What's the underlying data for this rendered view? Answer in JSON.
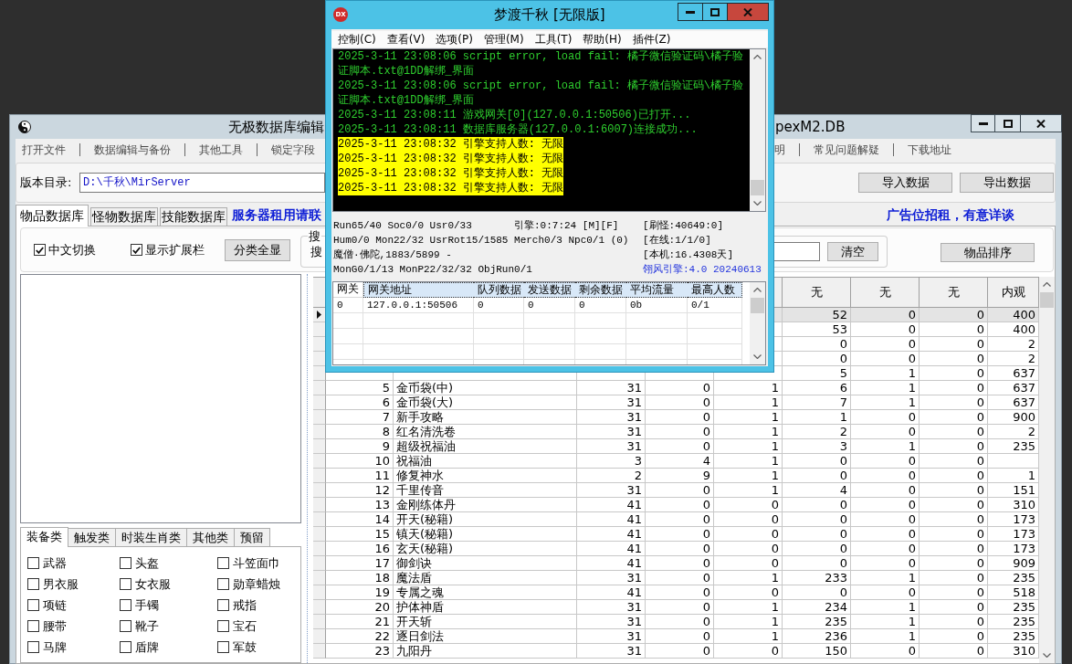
{
  "editor_window": {
    "title_left": "无极数据库编辑",
    "title_right": "pexM2.DB",
    "menu_left": [
      "打开文件",
      "数据编辑与备份",
      "其他工具",
      "锁定字段"
    ],
    "menu_right": [
      "明",
      "常见问题解疑",
      "下载地址"
    ],
    "directory": {
      "label": "版本目录:",
      "value": "D:\\千秋\\MirServer"
    },
    "import_button": "导入数据",
    "export_button": "导出数据",
    "tabs": [
      {
        "label": "物品数据库",
        "selected": true
      },
      {
        "label": "怪物数据库",
        "selected": false
      },
      {
        "label": "技能数据库",
        "selected": false
      }
    ],
    "notice": "服务器租用请联",
    "ad": "广告位招租，有意详谈",
    "options": [
      {
        "label": "中文切换",
        "checked": true
      },
      {
        "label": "显示扩展栏",
        "checked": true
      }
    ],
    "show_all_button": "分类全显",
    "search": {
      "title": "搜",
      "label": "搜",
      "clear_button": "清空"
    },
    "sort_button": "物品排序",
    "category_tabs": [
      {
        "label": "装备类",
        "selected": true
      },
      {
        "label": "触发类",
        "selected": false
      },
      {
        "label": "时装生肖类",
        "selected": false
      },
      {
        "label": "其他类",
        "selected": false
      },
      {
        "label": "预留",
        "selected": false
      }
    ],
    "categories": [
      {
        "label": "武器",
        "checked": false
      },
      {
        "label": "头盔",
        "checked": false
      },
      {
        "label": "斗笠面巾",
        "checked": false
      },
      {
        "label": "男衣服",
        "checked": false
      },
      {
        "label": "女衣服",
        "checked": false
      },
      {
        "label": "勋章蜡烛",
        "checked": false
      },
      {
        "label": "项链",
        "checked": false
      },
      {
        "label": "手镯",
        "checked": false
      },
      {
        "label": "戒指",
        "checked": false
      },
      {
        "label": "腰带",
        "checked": false
      },
      {
        "label": "靴子",
        "checked": false
      },
      {
        "label": "宝石",
        "checked": false
      },
      {
        "label": "马牌",
        "checked": false
      },
      {
        "label": "盾牌",
        "checked": false
      },
      {
        "label": "军鼓",
        "checked": false
      }
    ],
    "table": {
      "columns": [
        null,
        null,
        null,
        null,
        null,
        "无",
        "无",
        "无",
        "内观"
      ],
      "rows": [
        {
          "selected": true,
          "cells": [
            null,
            null,
            null,
            null,
            null,
            "52",
            "0",
            "0",
            "400"
          ]
        },
        {
          "selected": false,
          "cells": [
            null,
            null,
            null,
            null,
            null,
            "53",
            "0",
            "0",
            "400"
          ]
        },
        {
          "selected": false,
          "cells": [
            null,
            null,
            null,
            null,
            null,
            "0",
            "0",
            "0",
            "2"
          ]
        },
        {
          "selected": false,
          "cells": [
            null,
            null,
            null,
            null,
            null,
            "0",
            "0",
            "0",
            "2"
          ]
        },
        {
          "selected": false,
          "cells": [
            null,
            null,
            null,
            null,
            null,
            "5",
            "1",
            "0",
            "637"
          ]
        },
        {
          "selected": false,
          "cells": [
            "5",
            "金币袋(中)",
            "31",
            "0",
            "1",
            "6",
            "1",
            "0",
            "637"
          ]
        },
        {
          "selected": false,
          "cells": [
            "6",
            "金币袋(大)",
            "31",
            "0",
            "1",
            "7",
            "1",
            "0",
            "637"
          ]
        },
        {
          "selected": false,
          "cells": [
            "7",
            "新手攻略",
            "31",
            "0",
            "1",
            "1",
            "0",
            "0",
            "900"
          ]
        },
        {
          "selected": false,
          "cells": [
            "8",
            "红名清洗卷",
            "31",
            "0",
            "1",
            "2",
            "0",
            "0",
            "2"
          ]
        },
        {
          "selected": false,
          "cells": [
            "9",
            "超级祝福油",
            "31",
            "0",
            "1",
            "3",
            "1",
            "0",
            "235"
          ]
        },
        {
          "selected": false,
          "cells": [
            "10",
            "祝福油",
            "3",
            "4",
            "1",
            "0",
            "0",
            "0",
            null
          ]
        },
        {
          "selected": false,
          "cells": [
            "11",
            "修复神水",
            "2",
            "9",
            "1",
            "0",
            "0",
            "0",
            "1"
          ]
        },
        {
          "selected": false,
          "cells": [
            "12",
            "千里传音",
            "31",
            "0",
            "1",
            "4",
            "0",
            "0",
            "151"
          ]
        },
        {
          "selected": false,
          "cells": [
            "13",
            "金刚练体丹",
            "41",
            "0",
            "0",
            "0",
            "0",
            "0",
            "310"
          ]
        },
        {
          "selected": false,
          "cells": [
            "14",
            "开天(秘籍)",
            "41",
            "0",
            "0",
            "0",
            "0",
            "0",
            "173"
          ]
        },
        {
          "selected": false,
          "cells": [
            "15",
            "镇天(秘籍)",
            "41",
            "0",
            "0",
            "0",
            "0",
            "0",
            "173"
          ]
        },
        {
          "selected": false,
          "cells": [
            "16",
            "玄天(秘籍)",
            "41",
            "0",
            "0",
            "0",
            "0",
            "0",
            "173"
          ]
        },
        {
          "selected": false,
          "cells": [
            "17",
            "御剑诀",
            "41",
            "0",
            "0",
            "0",
            "0",
            "0",
            "909"
          ]
        },
        {
          "selected": false,
          "cells": [
            "18",
            "魔法盾",
            "31",
            "0",
            "1",
            "233",
            "1",
            "0",
            "235"
          ]
        },
        {
          "selected": false,
          "cells": [
            "19",
            "专属之魂",
            "41",
            "0",
            "0",
            "0",
            "0",
            "0",
            "518"
          ]
        },
        {
          "selected": false,
          "cells": [
            "20",
            "护体神盾",
            "31",
            "0",
            "1",
            "234",
            "1",
            "0",
            "235"
          ]
        },
        {
          "selected": false,
          "cells": [
            "21",
            "开天斩",
            "31",
            "0",
            "1",
            "235",
            "1",
            "0",
            "235"
          ]
        },
        {
          "selected": false,
          "cells": [
            "22",
            "逐日剑法",
            "31",
            "0",
            "1",
            "236",
            "1",
            "0",
            "235"
          ]
        },
        {
          "selected": false,
          "cells": [
            "23",
            "九阳丹",
            "31",
            "0",
            "0",
            "150",
            "0",
            "0",
            "310"
          ]
        }
      ]
    }
  },
  "monitor_window": {
    "icon_label": "DX",
    "title": "梦渡千秋 [无限版]",
    "menu": [
      "控制(C)",
      "查看(V)",
      "选项(P)",
      "管理(M)",
      "工具(T)",
      "帮助(H)",
      "插件(Z)"
    ],
    "log": [
      {
        "text": "2025-3-11 23:08:06 script error, load fail: 橘子微信验证码\\橘子验证脚本.txt@1DD解绑_界面",
        "highlighted": false
      },
      {
        "text": "2025-3-11 23:08:06 script error, load fail: 橘子微信验证码\\橘子验证脚本.txt@1DD解绑_界面",
        "highlighted": false
      },
      {
        "text": "2025-3-11 23:08:11 游戏网关[0](127.0.0.1:50506)已打开...",
        "highlighted": false
      },
      {
        "text": "2025-3-11 23:08:11 数据库服务器(127.0.0.1:6007)连接成功...",
        "highlighted": false
      },
      {
        "text": "2025-3-11 23:08:32 引擎支持人数: 无限",
        "highlighted": true
      },
      {
        "text": "2025-3-11 23:08:32 引擎支持人数: 无限",
        "highlighted": true
      },
      {
        "text": "2025-3-11 23:08:32 引擎支持人数: 无限",
        "highlighted": true
      },
      {
        "text": "2025-3-11 23:08:32 引擎支持人数: 无限",
        "highlighted": true
      }
    ],
    "status": {
      "lines": [
        "Run65/40 Soc0/0 Usr0/33",
        "Hum0/0 Mon22/32 UsrRot15/1585 Merch0/3 Npc0/1 (0)",
        "魔僧·佛陀,1883/5899 -",
        "MonG0/1/13 MonP22/32/32 ObjRun0/1"
      ],
      "engine_time": "引擎:0:7:24 [M][F]",
      "counters": [
        "[刷怪:40649:0]",
        "[在线:1/1/0]",
        "[本机:16.4308天]"
      ],
      "version": "翎风引擎:4.0 20240613"
    },
    "gateways": {
      "columns": [
        "网关",
        "网关地址",
        "队列数据",
        "发送数据",
        "剩余数据",
        "平均流量",
        "最高人数"
      ],
      "rows": [
        [
          "0",
          "127.0.0.1:50506",
          "0",
          "0",
          "0",
          "0b",
          "0/1"
        ]
      ]
    }
  }
}
